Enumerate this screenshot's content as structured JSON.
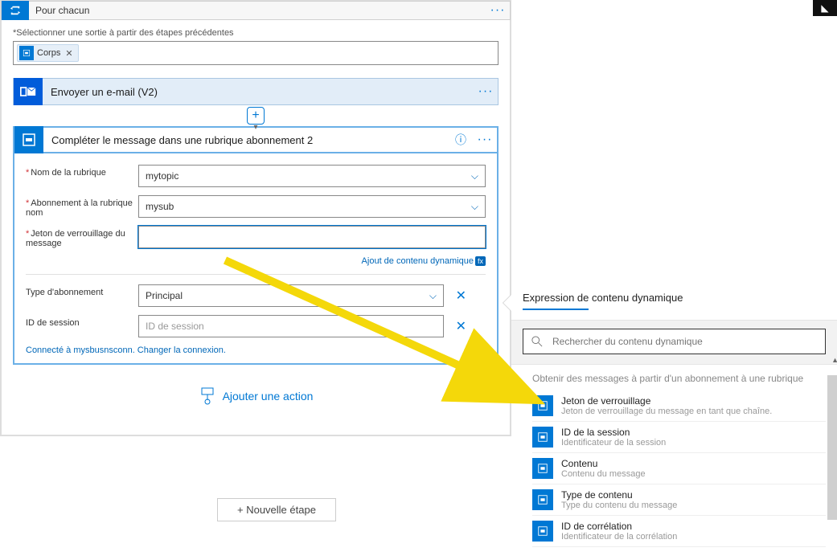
{
  "foreach": {
    "title": "Pour chacun",
    "select_output_label": "*Sélectionner une sortie à partir des étapes précédentes",
    "chip_label": "Corps"
  },
  "email_action": {
    "title": "Envoyer un e-mail (V2)"
  },
  "complete_action": {
    "title": "Compléter le message dans une rubrique abonnement 2",
    "fields": {
      "topic_label": "Nom de la rubrique",
      "topic_value": "mytopic",
      "sub_label": "Abonnement à la rubrique",
      "sub_label2": "nom",
      "sub_value": "mysub",
      "lock_label": "Jeton de verrouillage du",
      "lock_label2": "message",
      "lock_value": "",
      "add_dc_link": "Ajout de contenu dynamique",
      "subtype_label": "Type d'abonnement",
      "subtype_value": "Principal",
      "session_label": "ID de session",
      "session_placeholder": "ID de session"
    },
    "connection_text": "Connecté à mysbusnsconn. Changer la connexion."
  },
  "add_action_label": "Ajouter une action",
  "new_step_label": "+  Nouvelle étape",
  "dyn_panel": {
    "title": "Expression de contenu dynamique",
    "search_placeholder": "Rechercher du contenu dynamique",
    "section_title": "Obtenir des messages à partir d'un abonnement à une rubrique",
    "items": [
      {
        "title": "Jeton de verrouillage",
        "desc": "Jeton de verrouillage du message en tant que chaîne."
      },
      {
        "title": "ID de la session",
        "desc": "Identificateur de la session"
      },
      {
        "title": "Contenu",
        "desc": "Contenu du message"
      },
      {
        "title": "Type de contenu",
        "desc": "Type du contenu du message"
      },
      {
        "title": "ID de corrélation",
        "desc": "Identificateur de la corrélation"
      }
    ]
  }
}
